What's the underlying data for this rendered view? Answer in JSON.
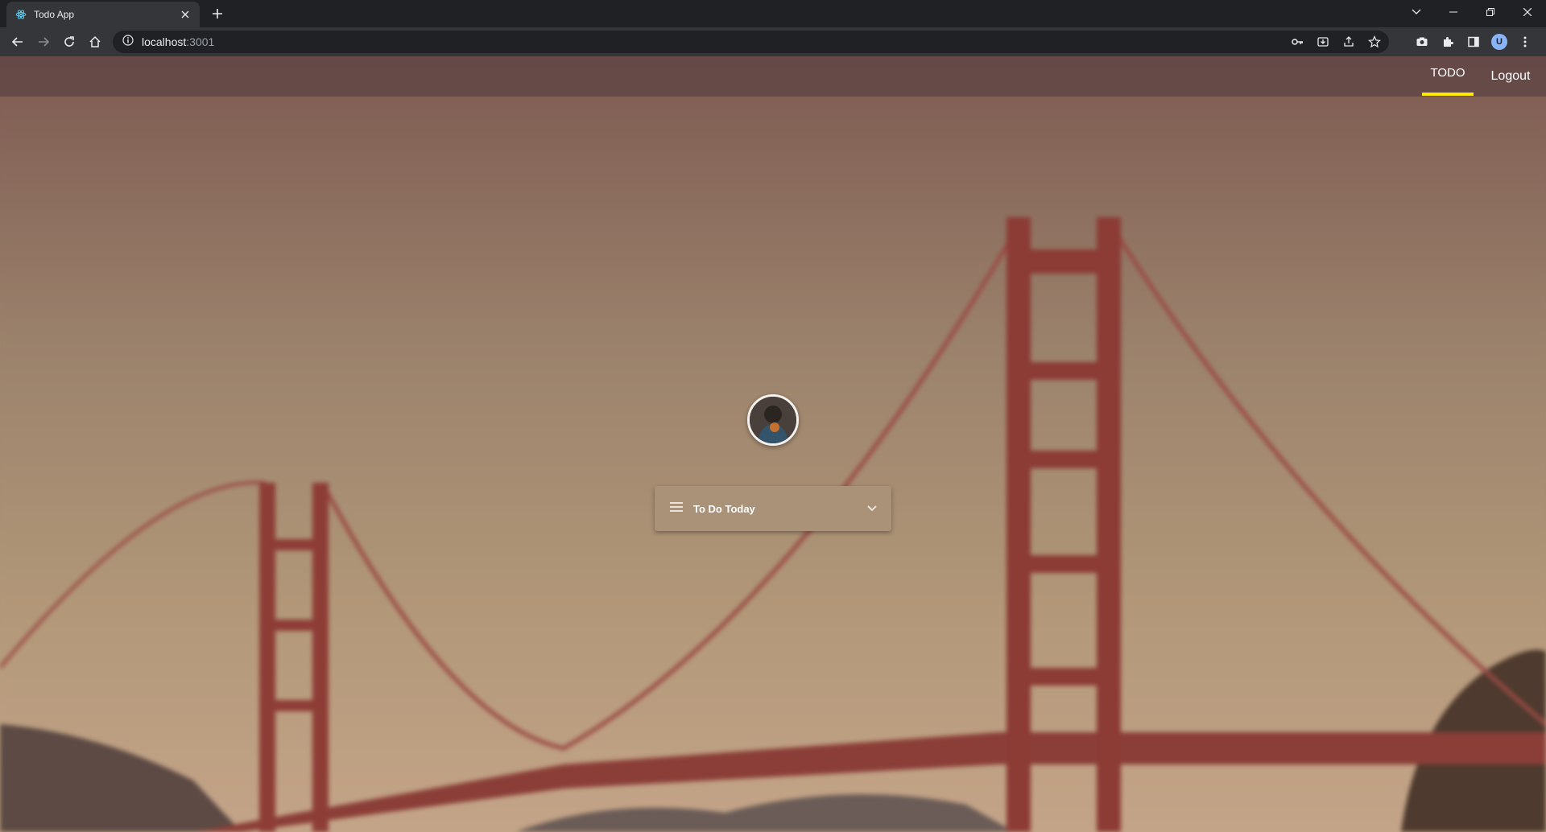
{
  "browser": {
    "tab_title": "Todo App",
    "url_host": "localhost",
    "url_port": ":3001",
    "profile_initial": "U"
  },
  "header": {
    "nav": [
      {
        "label": "TODO",
        "active": true
      },
      {
        "label": "Logout",
        "active": false
      }
    ],
    "accent": "#ffeb00"
  },
  "main": {
    "list_select_label": "To Do Today"
  }
}
